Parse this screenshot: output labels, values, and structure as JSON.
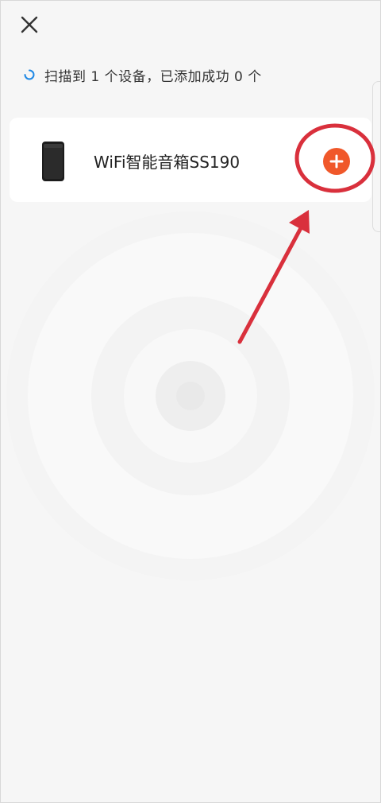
{
  "header": {
    "close_icon": "close-icon"
  },
  "scan_status": {
    "text": "扫描到 1 个设备，已添加成功 0 个",
    "spinner_icon": "loading-spinner-icon",
    "spinner_color": "#1e88e5"
  },
  "devices": [
    {
      "name": "WiFi智能音箱SS190",
      "image_icon": "smart-speaker-icon",
      "add_icon": "add-circle-icon",
      "add_color": "#f0582a"
    }
  ],
  "annotation": {
    "highlight_color": "#d9303c"
  }
}
